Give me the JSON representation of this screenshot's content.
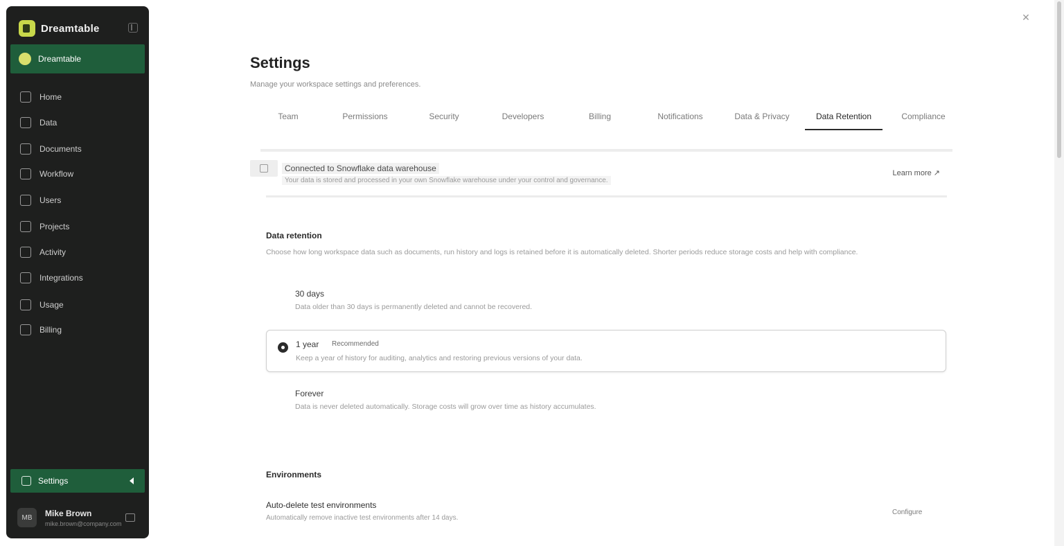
{
  "app": {
    "name": "Dreamtable"
  },
  "sidebar": {
    "active_item": "Dreamtable",
    "items": [
      {
        "label": "Home",
        "icon": "home-icon"
      },
      {
        "label": "Data",
        "icon": "database-icon"
      },
      {
        "label": "Documents",
        "icon": "document-icon"
      },
      {
        "label": "Workflow",
        "icon": "workflow-icon"
      },
      {
        "label": "Users",
        "icon": "users-icon"
      },
      {
        "label": "Projects",
        "icon": "projects-icon"
      },
      {
        "label": "Activity",
        "icon": "activity-icon"
      },
      {
        "label": "Integrations",
        "icon": "integrations-icon"
      },
      {
        "label": "Usage",
        "icon": "usage-icon"
      },
      {
        "label": "Billing",
        "icon": "billing-icon"
      }
    ],
    "settings_label": "Settings",
    "user": {
      "initials": "MB",
      "name": "Mike Brown",
      "email": "mike.brown@company.com"
    }
  },
  "main": {
    "title": "Settings",
    "subtitle": "Manage your workspace settings and preferences.",
    "tabs": [
      {
        "label": "Team"
      },
      {
        "label": "Permissions"
      },
      {
        "label": "Security"
      },
      {
        "label": "Developers"
      },
      {
        "label": "Billing"
      },
      {
        "label": "Notifications"
      },
      {
        "label": "Data & Privacy"
      },
      {
        "label": "Data Retention"
      },
      {
        "label": "Compliance"
      }
    ],
    "active_tab": 7,
    "banner": {
      "title": "Connected to Snowflake data warehouse",
      "description": "Your data is stored and processed in your own Snowflake warehouse under your control and governance.",
      "link": "Learn more ↗"
    },
    "data_retention": {
      "title": "Data retention",
      "description": "Choose how long workspace data such as documents, run history and logs is retained before it is automatically deleted. Shorter periods reduce storage costs and help with compliance.",
      "options": [
        {
          "title": "30 days",
          "description": "Data older than 30 days is permanently deleted and cannot be recovered."
        },
        {
          "title": "1 year",
          "badge": "Recommended",
          "description": "Keep a year of history for auditing, analytics and restoring previous versions of your data."
        },
        {
          "title": "Forever",
          "description": "Data is never deleted automatically. Storage costs will grow over time as history accumulates."
        }
      ],
      "selected_index": 1
    },
    "environments": {
      "title": "Environments",
      "row_title": "Auto-delete test environments",
      "row_description": "Automatically remove inactive test environments after 14 days.",
      "row_action": "Configure"
    }
  }
}
